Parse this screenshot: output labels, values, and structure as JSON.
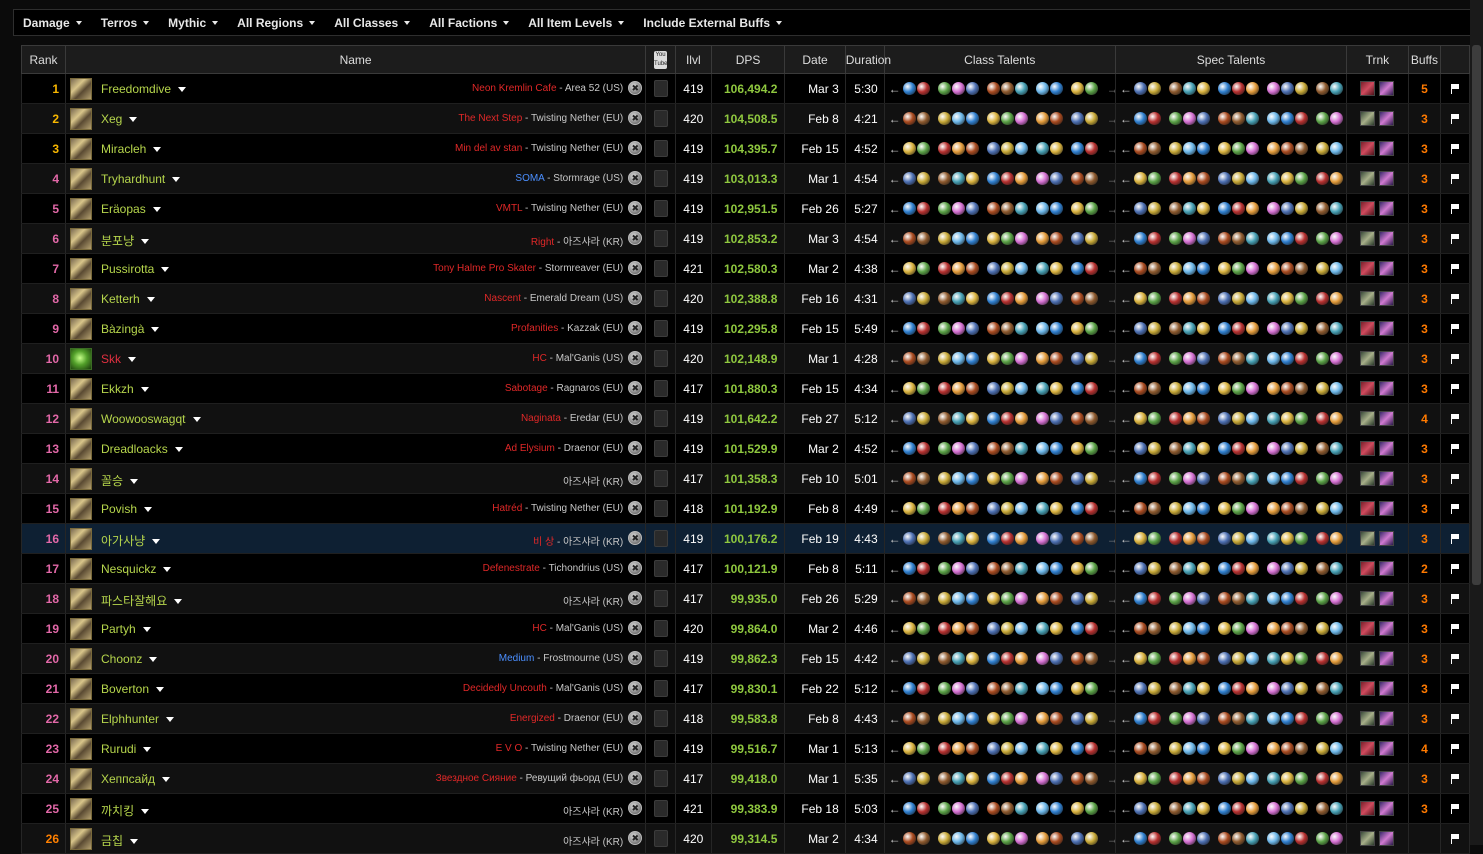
{
  "filters": [
    "Damage",
    "Terros",
    "Mythic",
    "All Regions",
    "All Classes",
    "All Factions",
    "All Item Levels",
    "Include External Buffs"
  ],
  "headers": {
    "rank": "Rank",
    "name": "Name",
    "video_icon": "YouTube",
    "ilvl": "Ilvl",
    "dps": "DPS",
    "date": "Date",
    "duration": "Duration",
    "class_talents": "Class Talents",
    "spec_talents": "Spec Talents",
    "trinkets": "Trnk",
    "buffs": "Buffs"
  },
  "colors": {
    "rank_top3": "#f8b700",
    "rank_default": "#e268a8",
    "rank_legendary": "#ff8000",
    "name": "#b6d64c",
    "name_alt": "#e03040",
    "dps": "#8fc83f",
    "buffs": "#ff7a00",
    "guild": "#e02828",
    "guild_blue": "#4b8fff",
    "highlight_row": "#0e2033"
  },
  "rows": [
    {
      "rank": "1",
      "name": "Freedomdive",
      "guild": "Neon Kremlin Cafe",
      "server": " - Area 52 (US)",
      "ilvl": "419",
      "dps": "106,494.2",
      "date": "Mar 3",
      "duration": "5:30",
      "buffs": "5"
    },
    {
      "rank": "2",
      "name": "Xeg",
      "guild": "The Next Step",
      "server": " - Twisting Nether (EU)",
      "ilvl": "420",
      "dps": "104,508.5",
      "date": "Feb 8",
      "duration": "4:21",
      "buffs": "3"
    },
    {
      "rank": "3",
      "name": "Miracleh",
      "guild": "Min del av stan",
      "server": " - Twisting Nether (EU)",
      "ilvl": "419",
      "dps": "104,395.7",
      "date": "Feb 15",
      "duration": "4:52",
      "buffs": "3"
    },
    {
      "rank": "4",
      "name": "Tryhardhunt",
      "guild": "SOMA",
      "server": " - Stormrage (US)",
      "ilvl": "419",
      "dps": "103,013.3",
      "date": "Mar 1",
      "duration": "4:54",
      "buffs": "3",
      "guild_blue": true
    },
    {
      "rank": "5",
      "name": "Eräopas",
      "guild": "VMTL",
      "server": " - Twisting Nether (EU)",
      "ilvl": "419",
      "dps": "102,951.5",
      "date": "Feb 26",
      "duration": "5:27",
      "buffs": "3"
    },
    {
      "rank": "6",
      "name": "분포냥",
      "guild": "Right",
      "server": " - 아즈샤라 (KR)",
      "ilvl": "419",
      "dps": "102,853.2",
      "date": "Mar 3",
      "duration": "4:54",
      "buffs": "3"
    },
    {
      "rank": "7",
      "name": "Pussirotta",
      "guild": "Tony Halme Pro Skater",
      "server": " - Stormreaver (EU)",
      "ilvl": "421",
      "dps": "102,580.3",
      "date": "Mar 2",
      "duration": "4:38",
      "buffs": "3"
    },
    {
      "rank": "8",
      "name": "Ketterh",
      "guild": "Nascent",
      "server": " - Emerald Dream (US)",
      "ilvl": "420",
      "dps": "102,388.8",
      "date": "Feb 16",
      "duration": "4:31",
      "buffs": "3"
    },
    {
      "rank": "9",
      "name": "Bàzingà",
      "guild": "Profanities",
      "server": " - Kazzak (EU)",
      "ilvl": "419",
      "dps": "102,295.8",
      "date": "Feb 15",
      "duration": "5:49",
      "buffs": "3"
    },
    {
      "rank": "10",
      "name": "Skk",
      "guild": "HC",
      "server": " - Mal'Ganis (US)",
      "ilvl": "420",
      "dps": "102,148.9",
      "date": "Mar 1",
      "duration": "4:28",
      "buffs": "3",
      "alt": true
    },
    {
      "rank": "11",
      "name": "Ekkzh",
      "guild": "Sabotage",
      "server": " - Ragnaros (EU)",
      "ilvl": "417",
      "dps": "101,880.3",
      "date": "Feb 15",
      "duration": "4:34",
      "buffs": "3"
    },
    {
      "rank": "12",
      "name": "Woowooswagqt",
      "guild": "Naginata",
      "server": " - Eredar (EU)",
      "ilvl": "419",
      "dps": "101,642.2",
      "date": "Feb 27",
      "duration": "5:12",
      "buffs": "4"
    },
    {
      "rank": "13",
      "name": "Dreadloacks",
      "guild": "Ad Elysium",
      "server": " - Draenor (EU)",
      "ilvl": "419",
      "dps": "101,529.9",
      "date": "Mar 2",
      "duration": "4:52",
      "buffs": "3"
    },
    {
      "rank": "14",
      "name": "꼴승",
      "guild": "",
      "server": "아즈샤라 (KR)",
      "ilvl": "417",
      "dps": "101,358.3",
      "date": "Feb 10",
      "duration": "5:01",
      "buffs": "3"
    },
    {
      "rank": "15",
      "name": "Povish",
      "guild": "Hatréd",
      "server": " - Twisting Nether (EU)",
      "ilvl": "418",
      "dps": "101,192.9",
      "date": "Feb 8",
      "duration": "4:49",
      "buffs": "3"
    },
    {
      "rank": "16",
      "name": "아가사냥",
      "guild": "비 상",
      "server": " - 아즈샤라 (KR)",
      "ilvl": "419",
      "dps": "100,176.2",
      "date": "Feb 19",
      "duration": "4:43",
      "buffs": "3",
      "highlight": true
    },
    {
      "rank": "17",
      "name": "Nesquickz",
      "guild": "Defenestrate",
      "server": " - Tichondrius (US)",
      "ilvl": "417",
      "dps": "100,121.9",
      "date": "Feb 8",
      "duration": "5:11",
      "buffs": "2"
    },
    {
      "rank": "18",
      "name": "파스타잘해요",
      "guild": "",
      "server": "아즈샤라 (KR)",
      "ilvl": "417",
      "dps": "99,935.0",
      "date": "Feb 26",
      "duration": "5:29",
      "buffs": "3"
    },
    {
      "rank": "19",
      "name": "Partyh",
      "guild": "HC",
      "server": " - Mal'Ganis (US)",
      "ilvl": "420",
      "dps": "99,864.0",
      "date": "Mar 2",
      "duration": "4:46",
      "buffs": "3"
    },
    {
      "rank": "20",
      "name": "Choonz",
      "guild": "Medium",
      "server": " - Frostmourne (US)",
      "ilvl": "419",
      "dps": "99,862.3",
      "date": "Feb 15",
      "duration": "4:42",
      "buffs": "3",
      "guild_blue": true
    },
    {
      "rank": "21",
      "name": "Boverton",
      "guild": "Decidedly Uncouth",
      "server": " - Mal'Ganis (US)",
      "ilvl": "417",
      "dps": "99,830.1",
      "date": "Feb 22",
      "duration": "5:12",
      "buffs": "3"
    },
    {
      "rank": "22",
      "name": "Elphhunter",
      "guild": "Energized",
      "server": " - Draenor (EU)",
      "ilvl": "418",
      "dps": "99,583.8",
      "date": "Feb 8",
      "duration": "4:43",
      "buffs": "3"
    },
    {
      "rank": "23",
      "name": "Rurudi",
      "guild": "E V O",
      "server": " - Twisting Nether (EU)",
      "ilvl": "419",
      "dps": "99,516.7",
      "date": "Mar 1",
      "duration": "5:13",
      "buffs": "4"
    },
    {
      "rank": "24",
      "name": "Хеппсайд",
      "guild": "Звездное Сияние",
      "server": " - Ревущий фьорд (EU)",
      "ilvl": "417",
      "dps": "99,418.0",
      "date": "Mar 1",
      "duration": "5:35",
      "buffs": "3"
    },
    {
      "rank": "25",
      "name": "까치킹",
      "guild": "",
      "server": "아즈샤라 (KR)",
      "ilvl": "421",
      "dps": "99,383.9",
      "date": "Feb 18",
      "duration": "5:03",
      "buffs": "3"
    },
    {
      "rank": "26",
      "name": "금칩",
      "guild": "",
      "server": "아즈샤라 (KR)",
      "ilvl": "420",
      "dps": "99,314.5",
      "date": "Mar 2",
      "duration": "4:34",
      "buffs": ""
    }
  ]
}
